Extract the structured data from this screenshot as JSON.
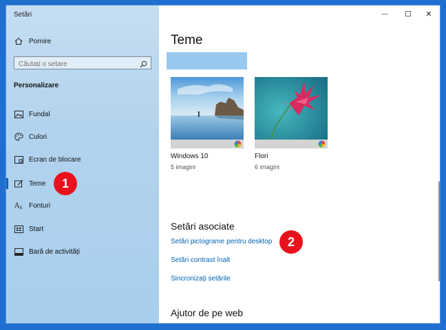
{
  "window": {
    "app_title": "Setări"
  },
  "titlebar": {
    "minimize": "—",
    "maximize": "☐",
    "close": "✕"
  },
  "sidebar": {
    "home_label": "Pornire",
    "search_placeholder": "Căutați o setare",
    "section_header": "Personalizare",
    "items": [
      {
        "label": "Fundal",
        "icon": "image-icon"
      },
      {
        "label": "Culori",
        "icon": "palette-icon"
      },
      {
        "label": "Ecran de blocare",
        "icon": "lock-screen-icon"
      },
      {
        "label": "Teme",
        "icon": "themes-icon",
        "selected": true
      },
      {
        "label": "Fonturi",
        "icon": "fonts-icon"
      },
      {
        "label": "Start",
        "icon": "start-icon"
      },
      {
        "label": "Bară de activități",
        "icon": "taskbar-icon"
      }
    ]
  },
  "main": {
    "title": "Teme",
    "themes": [
      {
        "name": "Windows 10",
        "count": "5 imagini"
      },
      {
        "name": "Flori",
        "count": "6 imagini"
      }
    ],
    "related_header": "Setări asociate",
    "related_links": [
      "Setări pictograme pentru desktop",
      "Setări contrast înalt",
      "Sincronizați setările"
    ],
    "web_header": "Ajutor de pe web"
  },
  "annotations": {
    "badge1": "1",
    "badge2": "2"
  },
  "colors": {
    "accent": "#0067c0",
    "link": "#0063b1",
    "badge": "#e8121c",
    "desktop": "#1f6fd0"
  }
}
